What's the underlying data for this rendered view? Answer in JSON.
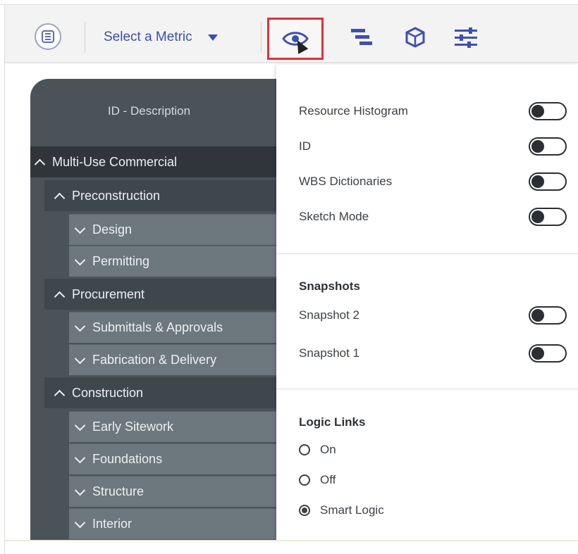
{
  "toolbar": {
    "metric_label": "Select a Metric",
    "icons": [
      "app-logo-icon",
      "eye-icon",
      "gantt-bars-icon",
      "cube-icon",
      "sliders-icon"
    ],
    "highlight_color": "#e2303a",
    "accent_color": "#3d4fb0"
  },
  "tree": {
    "header": "ID - Description",
    "rows": [
      {
        "label": "Multi-Use Commercial",
        "level": 0,
        "expanded": true
      },
      {
        "label": "Preconstruction",
        "level": 1,
        "expanded": true
      },
      {
        "label": "Design",
        "level": 2,
        "expanded": false
      },
      {
        "label": "Permitting",
        "level": 2,
        "expanded": false
      },
      {
        "label": "Procurement",
        "level": 1,
        "expanded": true
      },
      {
        "label": "Submittals & Approvals",
        "level": 2,
        "expanded": false
      },
      {
        "label": "Fabrication & Delivery",
        "level": 2,
        "expanded": false
      },
      {
        "label": "Construction",
        "level": 1,
        "expanded": true
      },
      {
        "label": "Early Sitework",
        "level": 2,
        "expanded": false
      },
      {
        "label": "Foundations",
        "level": 2,
        "expanded": false
      },
      {
        "label": "Structure",
        "level": 2,
        "expanded": false
      },
      {
        "label": "Interior",
        "level": 2,
        "expanded": false
      }
    ]
  },
  "settings": {
    "toggles": [
      {
        "label": "Resource Histogram",
        "on": false
      },
      {
        "label": "ID",
        "on": false
      },
      {
        "label": "WBS Dictionaries",
        "on": false
      },
      {
        "label": "Sketch Mode",
        "on": false
      }
    ],
    "snapshots": {
      "title": "Snapshots",
      "items": [
        {
          "label": "Snapshot 2",
          "on": false
        },
        {
          "label": "Snapshot 1",
          "on": false
        }
      ]
    },
    "logic_links": {
      "title": "Logic Links",
      "options": [
        {
          "label": "On",
          "selected": false
        },
        {
          "label": "Off",
          "selected": false
        },
        {
          "label": "Smart Logic",
          "selected": true
        }
      ]
    }
  }
}
